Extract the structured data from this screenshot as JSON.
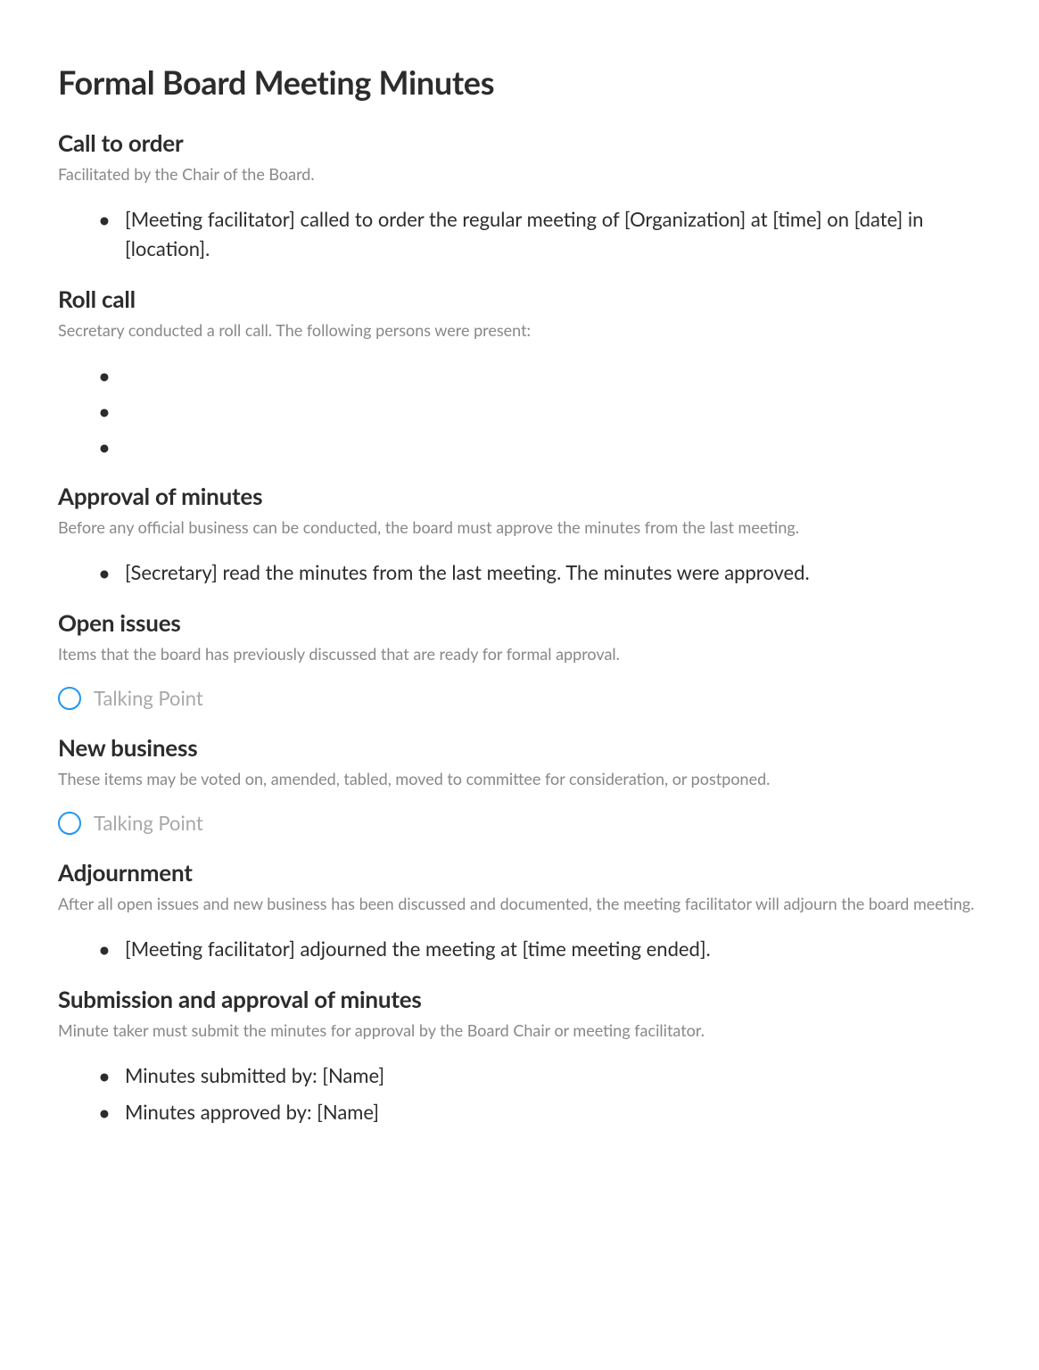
{
  "title": "Formal Board Meeting Minutes",
  "sections": {
    "call_to_order": {
      "heading": "Call to order",
      "subtitle": "Facilitated by the Chair of the Board.",
      "items": [
        "[Meeting facilitator] called to order the regular meeting of [Organization] at [time] on [date] in [location]."
      ]
    },
    "roll_call": {
      "heading": "Roll call",
      "subtitle": "Secretary conducted a roll call. The following persons were present:",
      "items": [
        "",
        "",
        ""
      ]
    },
    "approval": {
      "heading": "Approval of minutes",
      "subtitle": "Before any official business can be conducted, the board must approve the minutes from the last meeting.",
      "items": [
        "[Secretary] read the minutes from the last meeting. The minutes were approved."
      ]
    },
    "open_issues": {
      "heading": "Open issues",
      "subtitle": "Items that the board has previously discussed that are ready for formal approval.",
      "talking_point": "Talking Point"
    },
    "new_business": {
      "heading": "New business",
      "subtitle": "These items may be voted on, amended, tabled, moved to committee for consideration, or postponed.",
      "talking_point": "Talking Point"
    },
    "adjournment": {
      "heading": "Adjournment",
      "subtitle": "After all open issues and new business has been discussed and documented, the meeting facilitator will adjourn the board meeting.",
      "items": [
        "[Meeting facilitator] adjourned the meeting at [time meeting ended]."
      ]
    },
    "submission": {
      "heading": "Submission and approval of minutes",
      "subtitle": "Minute taker must submit the minutes for approval by the Board Chair or meeting facilitator.",
      "items": [
        "Minutes submitted by: [Name]",
        "Minutes approved by: [Name]"
      ]
    }
  }
}
